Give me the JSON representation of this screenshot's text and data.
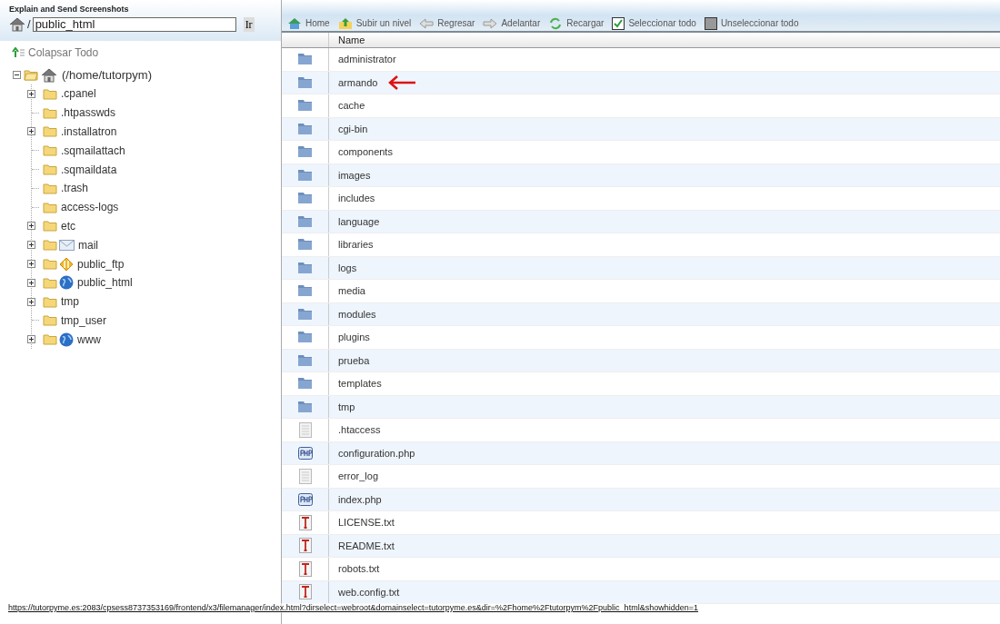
{
  "top_bar": {
    "title": "Explain and Send Screenshots",
    "path_separator": "/",
    "path_value": "public_html",
    "go_button": "Ir"
  },
  "collapse_all": "Colapsar Todo",
  "tree": [
    {
      "label": "(/home/tutorpym)",
      "kind": "home",
      "expanded": true,
      "children": [
        {
          "label": ".cpanel",
          "kind": "folder",
          "expandable": true
        },
        {
          "label": ".htpasswds",
          "kind": "folder",
          "expandable": false
        },
        {
          "label": ".installatron",
          "kind": "folder",
          "expandable": true
        },
        {
          "label": ".sqmailattach",
          "kind": "folder",
          "expandable": false
        },
        {
          "label": ".sqmaildata",
          "kind": "folder",
          "expandable": false
        },
        {
          "label": ".trash",
          "kind": "folder",
          "expandable": false
        },
        {
          "label": "access-logs",
          "kind": "folder",
          "expandable": false
        },
        {
          "label": "etc",
          "kind": "folder",
          "expandable": true
        },
        {
          "label": "mail",
          "kind": "mail",
          "expandable": true
        },
        {
          "label": "public_ftp",
          "kind": "ftp",
          "expandable": true
        },
        {
          "label": "public_html",
          "kind": "web",
          "expandable": true
        },
        {
          "label": "tmp",
          "kind": "folder",
          "expandable": true
        },
        {
          "label": "tmp_user",
          "kind": "folder",
          "expandable": false
        },
        {
          "label": "www",
          "kind": "web",
          "expandable": true
        }
      ]
    }
  ],
  "toolbar": [
    {
      "label": "Home",
      "kind": "home"
    },
    {
      "label": "Subir un nivel",
      "kind": "up"
    },
    {
      "label": "Regresar",
      "kind": "back"
    },
    {
      "label": "Adelantar",
      "kind": "forward"
    },
    {
      "label": "Recargar",
      "kind": "reload"
    },
    {
      "label": "Seleccionar todo",
      "kind": "select"
    },
    {
      "label": "Unseleccionar todo",
      "kind": "unselect"
    }
  ],
  "table": {
    "columns": [
      "Name"
    ],
    "rows": [
      {
        "name": "administrator",
        "kind": "folder",
        "arrow": false
      },
      {
        "name": "armando",
        "kind": "folder",
        "arrow": true
      },
      {
        "name": "cache",
        "kind": "folder",
        "arrow": false
      },
      {
        "name": "cgi-bin",
        "kind": "folder",
        "arrow": false
      },
      {
        "name": "components",
        "kind": "folder",
        "arrow": false
      },
      {
        "name": "images",
        "kind": "folder",
        "arrow": false
      },
      {
        "name": "includes",
        "kind": "folder",
        "arrow": false
      },
      {
        "name": "language",
        "kind": "folder",
        "arrow": false
      },
      {
        "name": "libraries",
        "kind": "folder",
        "arrow": false
      },
      {
        "name": "logs",
        "kind": "folder",
        "arrow": false
      },
      {
        "name": "media",
        "kind": "folder",
        "arrow": false
      },
      {
        "name": "modules",
        "kind": "folder",
        "arrow": false
      },
      {
        "name": "plugins",
        "kind": "folder",
        "arrow": false
      },
      {
        "name": "prueba",
        "kind": "folder",
        "arrow": false
      },
      {
        "name": "templates",
        "kind": "folder",
        "arrow": false
      },
      {
        "name": "tmp",
        "kind": "folder",
        "arrow": false
      },
      {
        "name": ".htaccess",
        "kind": "file",
        "arrow": false
      },
      {
        "name": "configuration.php",
        "kind": "php",
        "arrow": false
      },
      {
        "name": "error_log",
        "kind": "file",
        "arrow": false
      },
      {
        "name": "index.php",
        "kind": "php",
        "arrow": false
      },
      {
        "name": "LICENSE.txt",
        "kind": "text",
        "arrow": false
      },
      {
        "name": "README.txt",
        "kind": "text",
        "arrow": false
      },
      {
        "name": "robots.txt",
        "kind": "text",
        "arrow": false
      },
      {
        "name": "web.config.txt",
        "kind": "text",
        "arrow": false
      }
    ]
  },
  "status_url": "https://tutorpyme.es:2083/cpsess8737353169/frontend/x3/filemanager/index.html?dirselect=webroot&domainselect=tutorpyme.es&dir=%2Fhome%2Ftutorpym%2Fpublic_html&showhidden=1"
}
